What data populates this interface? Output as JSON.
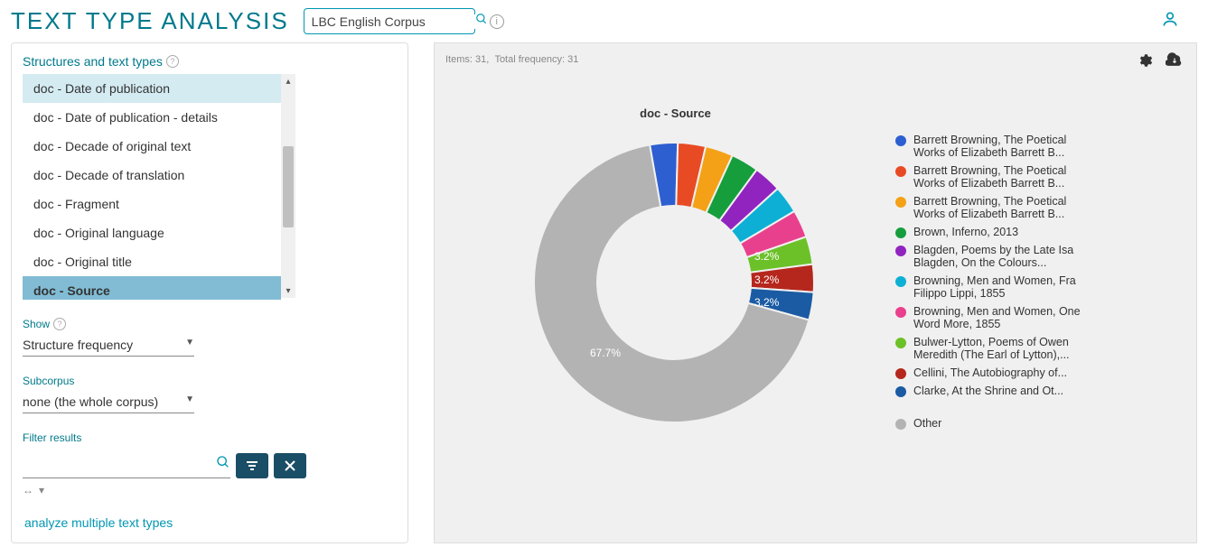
{
  "header": {
    "title": "TEXT TYPE ANALYSIS",
    "search_value": "LBC English Corpus"
  },
  "sidebar": {
    "section_label": "Structures and text types",
    "items": [
      {
        "label": "doc - Date of publication",
        "state": "highlight"
      },
      {
        "label": "doc - Date of publication - details",
        "state": ""
      },
      {
        "label": "doc - Decade of original text",
        "state": ""
      },
      {
        "label": "doc - Decade of translation",
        "state": ""
      },
      {
        "label": "doc - Fragment",
        "state": ""
      },
      {
        "label": "doc - Original language",
        "state": ""
      },
      {
        "label": "doc - Original title",
        "state": ""
      },
      {
        "label": "doc - Source",
        "state": "selected"
      }
    ],
    "show_label": "Show",
    "show_value": "Structure frequency",
    "subcorpus_label": "Subcorpus",
    "subcorpus_value": "none (the whole corpus)",
    "filter_label": "Filter results",
    "analyze_link": "analyze multiple text types"
  },
  "stats": {
    "items_label": "Items:",
    "items_value": "31",
    "totalfreq_label": "Total frequency:",
    "totalfreq_value": "31"
  },
  "chart_data": {
    "type": "pie",
    "title": "doc - Source",
    "series": [
      {
        "name": "Barrett Browning, The Poetical Works of Elizabeth Barrett B...",
        "value": 3.2,
        "color": "#2d5fd1"
      },
      {
        "name": "Barrett Browning, The Poetical Works of Elizabeth Barrett B...",
        "value": 3.2,
        "color": "#e84b24"
      },
      {
        "name": "Barrett Browning, The Poetical Works of Elizabeth Barrett B...",
        "value": 3.2,
        "color": "#f4a117"
      },
      {
        "name": "Brown, Inferno, 2013",
        "value": 3.2,
        "color": "#169e3d"
      },
      {
        "name": "Blagden, Poems by the Late Isa Blagden, On the Colours...",
        "value": 3.2,
        "color": "#9124bf"
      },
      {
        "name": "Browning, Men and Women, Fra Filippo Lippi, 1855",
        "value": 3.2,
        "color": "#0db0d4"
      },
      {
        "name": "Browning, Men and Women, One Word More, 1855",
        "value": 3.2,
        "color": "#e9408d"
      },
      {
        "name": "Bulwer-Lytton, Poems of Owen Meredith (The Earl of Lytton),...",
        "value": 3.2,
        "color": "#6cc128"
      },
      {
        "name": "Cellini, The Autobiography of...",
        "value": 3.2,
        "color": "#b5271d"
      },
      {
        "name": "Clarke, At the Shrine and Ot...",
        "value": 3.2,
        "color": "#1a5ba3"
      },
      {
        "name": "Other",
        "value": 67.7,
        "color": "#b3b3b3"
      }
    ],
    "visible_labels": [
      "3.2%",
      "3.2%",
      "3.2%",
      "67.7%"
    ]
  }
}
